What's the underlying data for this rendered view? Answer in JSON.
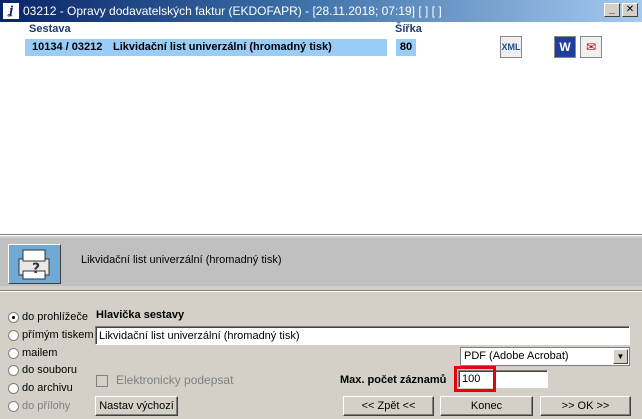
{
  "window": {
    "title": "03212 - Opravy dodavatelských faktur (EKDOFAPR) - [28.11.2018; 07:19]  [ ]  [ ]",
    "logo": "ʝ",
    "minimize_label": "_",
    "close_label": "✕"
  },
  "grid": {
    "columns": {
      "sestava": "Sestava",
      "sirka": "Šířka"
    },
    "rows": [
      {
        "code": "10134 / 03212",
        "name": "Likvidační list univerzální (hromadný tisk)",
        "width": "80"
      }
    ]
  },
  "format_buttons": [
    {
      "label": "XML",
      "icon": "xml-file-icon"
    },
    {
      "label": "W",
      "icon": "word-icon"
    },
    {
      "label": "✉",
      "icon": "pdf-icon"
    }
  ],
  "description": {
    "text": "Likvidační list univerzální (hromadný tisk)",
    "icon": "printer-icon"
  },
  "output_options": [
    {
      "label": "do prohlížeče",
      "selected": true,
      "enabled": true
    },
    {
      "label": "přímým tiskem",
      "selected": false,
      "enabled": true
    },
    {
      "label": "mailem",
      "selected": false,
      "enabled": true
    },
    {
      "label": "do souboru",
      "selected": false,
      "enabled": true
    },
    {
      "label": "do archivu",
      "selected": false,
      "enabled": true
    },
    {
      "label": "do přílohy",
      "selected": false,
      "enabled": false
    }
  ],
  "header_section": {
    "label": "Hlavička sestavy",
    "value": "Likvidační list univerzální (hromadný tisk)"
  },
  "format_select": {
    "value": "PDF (Adobe Acrobat)",
    "arrow": "▼"
  },
  "signature": {
    "label": "Elektronicky podepsat",
    "checked": false,
    "enabled": false
  },
  "max_records": {
    "label": "Max. počet záznamů",
    "value": "100"
  },
  "buttons": {
    "defaults": "Nastav výchozí",
    "back": "<< Zpět <<",
    "end": "Konec",
    "ok": ">> OK >>"
  },
  "colors": {
    "accent": "#0a246a",
    "selection": "#99ccf7",
    "highlight": "#e8000b"
  }
}
